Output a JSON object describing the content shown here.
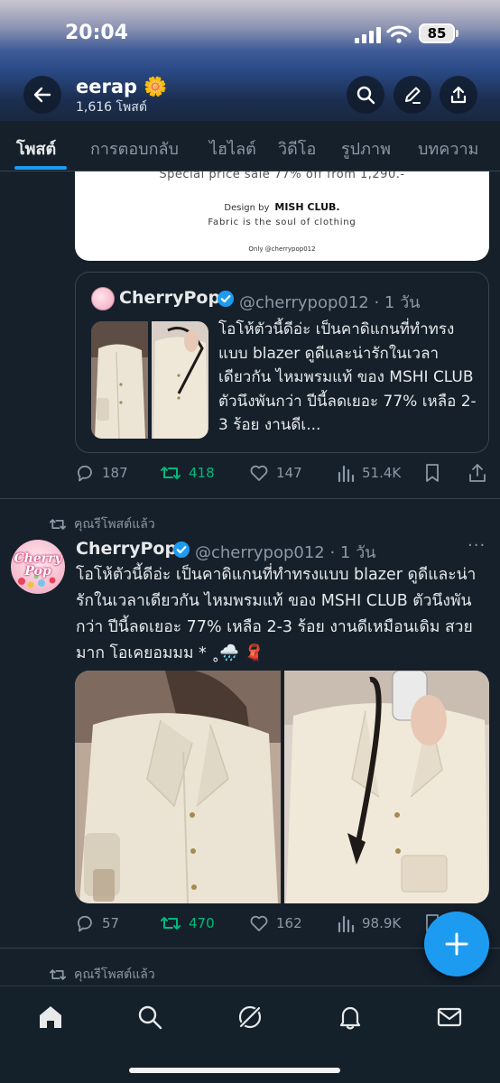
{
  "status": {
    "time": "20:04",
    "battery": "85"
  },
  "header": {
    "name": "eerap",
    "emoji": "🌼",
    "post_count": "1,616 โพสต์"
  },
  "tabs": [
    {
      "label": "โพสต์",
      "active": true
    },
    {
      "label": "การตอบกลับ",
      "active": false
    },
    {
      "label": "ไฮไลต์",
      "active": false
    },
    {
      "label": "วิดีโอ",
      "active": false
    },
    {
      "label": "รูปภาพ",
      "active": false
    },
    {
      "label": "บทความ",
      "active": false
    }
  ],
  "post1": {
    "image_card": {
      "line1": "Special price sale 77% off from 1,290.-",
      "design_by": "Design by",
      "brand": "MISH CLUB.",
      "tagline": "Fabric is the soul of clothing",
      "only": "Only @cherrypop012"
    },
    "quote": {
      "name": "CherryPop",
      "handle": "@cherrypop012 · 1 วัน",
      "text": "โอโห้ตัวนี้ดีอ่ะ เป็นคาดิแกนที่ทำทรงแบบ blazer ดูดีและน่ารักในเวลาเดียวกัน ไหมพรมแท้ ของ MSHI CLUB ตัวนึงพันกว่า ปีนี้ลดเยอะ 77% เหลือ 2-3 ร้อย งานดีเ..."
    },
    "actions": {
      "replies": "187",
      "reposts": "418",
      "likes": "147",
      "views": "51.4K"
    }
  },
  "post2": {
    "repost_label": "คุณรีโพสต์แล้ว",
    "avatar_text": "Cherry Pop",
    "name": "CherryPop",
    "handle": "@cherrypop012 · 1 วัน",
    "text": "โอโห้ตัวนี้ดีอ่ะ เป็นคาดิแกนที่ทำทรงแบบ blazer ดูดีและน่ารักในเวลาเดียวกัน ไหมพรมแท้ ของ MSHI CLUB ตัวนึงพันกว่า ปีนี้ลดเยอะ 77% เหลือ 2-3 ร้อย งานดีเหมือนเดิม สวยมาก โอเคยอมมม * ˳🌧️ 🧣",
    "actions": {
      "replies": "57",
      "reposts": "470",
      "likes": "162",
      "views": "98.9K"
    }
  },
  "post3": {
    "repost_label": "คุณรีโพสต์แล้ว"
  },
  "colors": {
    "background": "#15202b",
    "accent": "#1d9bf0",
    "repost_green": "#00ba7c",
    "muted": "#8b98a5"
  }
}
